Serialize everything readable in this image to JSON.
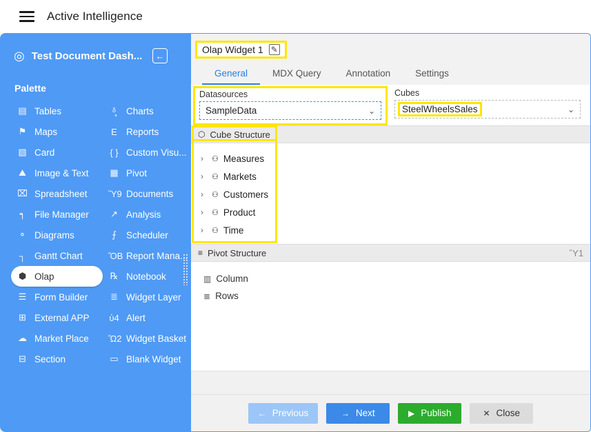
{
  "appbar": {
    "menu_icon": "hamburger-icon",
    "title": "Active Intelligence"
  },
  "sidebar": {
    "dashboard_icon": "dashboard-gauge-icon",
    "dashboard_title": "Test Document Dash...",
    "collapse_icon": "←",
    "palette_label": "Palette",
    "background_color": "#4f9af5",
    "items": [
      {
        "label": "Tables",
        "icon": "▤",
        "icon_name": "tables-icon",
        "selected": false
      },
      {
        "label": "Charts",
        "icon": "ᵟ͓",
        "icon_name": "charts-icon",
        "selected": false
      },
      {
        "label": "Maps",
        "icon": "⚑",
        "icon_name": "maps-icon",
        "selected": false
      },
      {
        "label": "Reports",
        "icon": "὜E",
        "icon_name": "reports-icon",
        "selected": false
      },
      {
        "label": "Card",
        "icon": "▧",
        "icon_name": "card-icon",
        "selected": false
      },
      {
        "label": "Custom Visu...",
        "icon": "{ }",
        "icon_name": "custom-visual-icon",
        "selected": false
      },
      {
        "label": "Image & Text",
        "icon": "⛰",
        "icon_name": "image-text-icon",
        "selected": false
      },
      {
        "label": "Pivot",
        "icon": "▦",
        "icon_name": "pivot-icon",
        "selected": false
      },
      {
        "label": "Spreadsheet",
        "icon": "⌧",
        "icon_name": "spreadsheet-icon",
        "selected": false
      },
      {
        "label": "Documents",
        "icon": "Ὓ9",
        "icon_name": "documents-icon",
        "selected": false
      },
      {
        "label": "File Manager",
        "icon": "┑",
        "icon_name": "file-manager-icon",
        "selected": false
      },
      {
        "label": "Analysis",
        "icon": "↗",
        "icon_name": "analysis-icon",
        "selected": false
      },
      {
        "label": "Diagrams",
        "icon": "⚬",
        "icon_name": "diagrams-icon",
        "selected": false
      },
      {
        "label": "Scheduler",
        "icon": "⨍",
        "icon_name": "scheduler-icon",
        "selected": false
      },
      {
        "label": "Gantt Chart",
        "icon": "┐",
        "icon_name": "gantt-chart-icon",
        "selected": false
      },
      {
        "label": "Report Mana...",
        "icon": "ὌB",
        "icon_name": "report-manager-icon",
        "selected": false
      },
      {
        "label": "Olap",
        "icon": "⬢",
        "icon_name": "olap-icon",
        "selected": true
      },
      {
        "label": "Notebook",
        "icon": "℞",
        "icon_name": "notebook-icon",
        "selected": false
      },
      {
        "label": "Form Builder",
        "icon": "☰",
        "icon_name": "form-builder-icon",
        "selected": false
      },
      {
        "label": "Widget Layer",
        "icon": "≣",
        "icon_name": "widget-layer-icon",
        "selected": false
      },
      {
        "label": "External APP",
        "icon": "⊞",
        "icon_name": "external-app-icon",
        "selected": false
      },
      {
        "label": "Alert",
        "icon": "ὑ4",
        "icon_name": "alert-bell-icon",
        "selected": false
      },
      {
        "label": "Market Place",
        "icon": "☁",
        "icon_name": "market-place-icon",
        "selected": false
      },
      {
        "label": "Widget Basket",
        "icon": "Ὥ2",
        "icon_name": "widget-basket-icon",
        "selected": false
      },
      {
        "label": "Section",
        "icon": "⊟",
        "icon_name": "section-icon",
        "selected": false
      },
      {
        "label": "Blank Widget",
        "icon": "▭",
        "icon_name": "blank-widget-icon",
        "selected": false
      }
    ],
    "resize_grip": "resize-grip"
  },
  "wizard": {
    "widget_title": "Olap Widget 1",
    "edit_icon": "✎",
    "highlight_color": "#ffe600",
    "accent_color": "#2b7fdb",
    "tabs": [
      {
        "label": "General",
        "active": true
      },
      {
        "label": "MDX Query",
        "active": false
      },
      {
        "label": "Annotation",
        "active": false
      },
      {
        "label": "Settings",
        "active": false
      }
    ],
    "datasources": {
      "label": "Datasources",
      "value": "SampleData",
      "chevron": "⌄"
    },
    "cubes": {
      "label": "Cubes",
      "value": "SteelWheelsSales",
      "chevron": "⌄"
    },
    "cube_structure": {
      "title": "Cube Structure",
      "icon": "⬡",
      "items": [
        {
          "label": "Measures",
          "caret": "›",
          "icon": "⚇"
        },
        {
          "label": "Markets",
          "caret": "›",
          "icon": "⚇"
        },
        {
          "label": "Customers",
          "caret": "›",
          "icon": "⚇"
        },
        {
          "label": "Product",
          "caret": "›",
          "icon": "⚇"
        },
        {
          "label": "Time",
          "caret": "›",
          "icon": "⚇"
        }
      ]
    },
    "pivot_structure": {
      "title": "Pivot Structure",
      "icon": "≡",
      "delete_icon": "Ὕ1",
      "items": [
        {
          "label": "Column",
          "icon": "▥"
        },
        {
          "label": "Rows",
          "icon": "≣"
        }
      ]
    },
    "footer_buttons": [
      {
        "label": "Previous",
        "icon": "←",
        "name": "previous"
      },
      {
        "label": "Next",
        "icon": "→",
        "name": "next"
      },
      {
        "label": "Publish",
        "icon": "▶",
        "name": "publish"
      },
      {
        "label": "Close",
        "icon": "✕",
        "name": "close"
      }
    ]
  }
}
